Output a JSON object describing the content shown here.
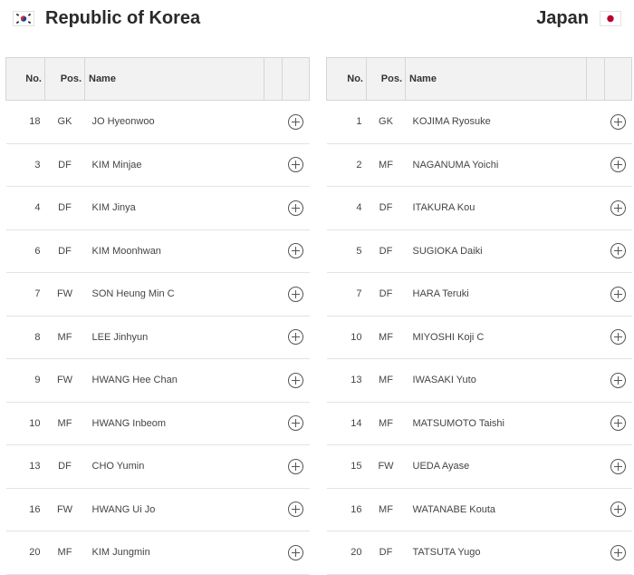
{
  "teams": {
    "home": {
      "name": "Republic of Korea",
      "flag": "korea-flag-icon",
      "players": [
        {
          "no": "18",
          "pos": "GK",
          "name": "JO Hyeonwoo"
        },
        {
          "no": "3",
          "pos": "DF",
          "name": "KIM Minjae"
        },
        {
          "no": "4",
          "pos": "DF",
          "name": "KIM Jinya"
        },
        {
          "no": "6",
          "pos": "DF",
          "name": "KIM Moonhwan"
        },
        {
          "no": "7",
          "pos": "FW",
          "name": "SON Heung Min C"
        },
        {
          "no": "8",
          "pos": "MF",
          "name": "LEE Jinhyun"
        },
        {
          "no": "9",
          "pos": "FW",
          "name": "HWANG Hee Chan"
        },
        {
          "no": "10",
          "pos": "MF",
          "name": "HWANG Inbeom"
        },
        {
          "no": "13",
          "pos": "DF",
          "name": "CHO Yumin"
        },
        {
          "no": "16",
          "pos": "FW",
          "name": "HWANG Ui Jo"
        },
        {
          "no": "20",
          "pos": "MF",
          "name": "KIM Jungmin"
        }
      ]
    },
    "away": {
      "name": "Japan",
      "flag": "japan-flag-icon",
      "players": [
        {
          "no": "1",
          "pos": "GK",
          "name": "KOJIMA Ryosuke"
        },
        {
          "no": "2",
          "pos": "MF",
          "name": "NAGANUMA Yoichi"
        },
        {
          "no": "4",
          "pos": "DF",
          "name": "ITAKURA Kou"
        },
        {
          "no": "5",
          "pos": "DF",
          "name": "SUGIOKA Daiki"
        },
        {
          "no": "7",
          "pos": "DF",
          "name": "HARA Teruki"
        },
        {
          "no": "10",
          "pos": "MF",
          "name": "MIYOSHI Koji C"
        },
        {
          "no": "13",
          "pos": "MF",
          "name": "IWASAKI Yuto"
        },
        {
          "no": "14",
          "pos": "MF",
          "name": "MATSUMOTO Taishi"
        },
        {
          "no": "15",
          "pos": "FW",
          "name": "UEDA Ayase"
        },
        {
          "no": "16",
          "pos": "MF",
          "name": "WATANABE Kouta"
        },
        {
          "no": "20",
          "pos": "DF",
          "name": "TATSUTA Yugo"
        }
      ]
    }
  },
  "columns": {
    "no": "No.",
    "pos": "Pos.",
    "name": "Name"
  },
  "icons": {
    "expand": "plus-circle-icon"
  },
  "colors": {
    "japan_red": "#bc002d",
    "korea_red": "#cd2e3a",
    "korea_blue": "#0047a0"
  }
}
